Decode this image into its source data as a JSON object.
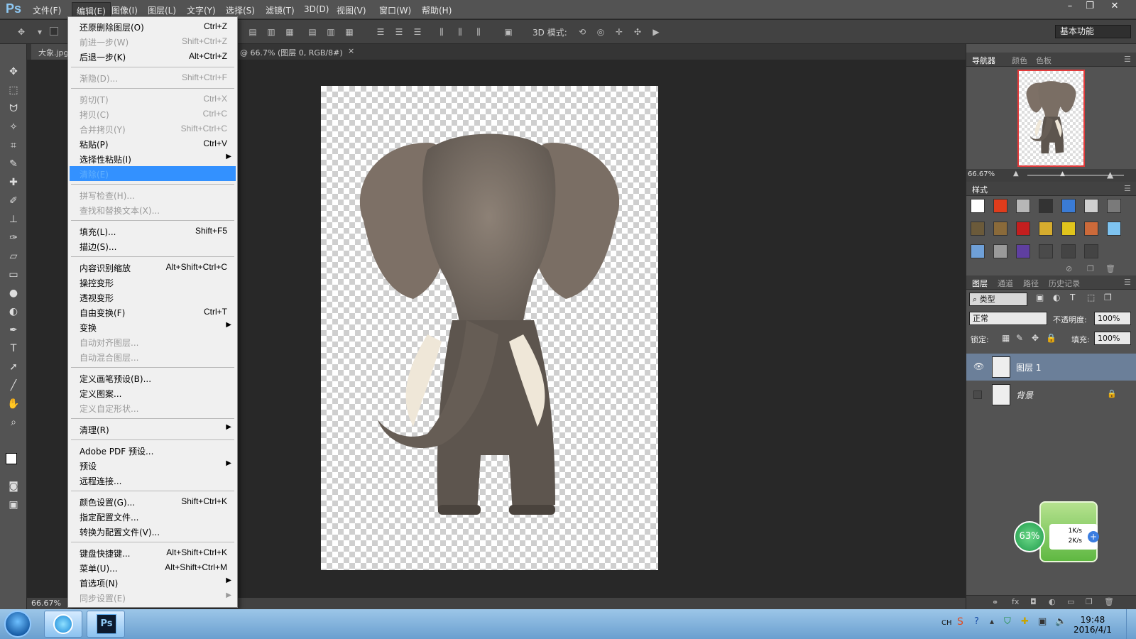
{
  "app": {
    "logo": "Ps"
  },
  "menubar": {
    "items": [
      "文件(F)",
      "编辑(E)",
      "图像(I)",
      "图层(L)",
      "文字(Y)",
      "选择(S)",
      "滤镜(T)",
      "3D(D)",
      "视图(V)",
      "窗口(W)",
      "帮助(H)"
    ],
    "active_index": 1
  },
  "window_controls": {
    "minimize": "–",
    "restore": "❐",
    "close": "✕"
  },
  "options_bar": {
    "mode_label": "3D 模式:",
    "workspace": "基本功能"
  },
  "tabs": {
    "doc_name": "大象.jpg",
    "doc_info": "@ 66.7% (图层 0, RGB/8#)",
    "close": "×"
  },
  "statusbar": {
    "zoom": "66.67%"
  },
  "edit_menu": {
    "groups": [
      [
        {
          "label": "还原删除图层(O)",
          "shortcut": "Ctrl+Z",
          "disabled": false
        },
        {
          "label": "前进一步(W)",
          "shortcut": "Shift+Ctrl+Z",
          "disabled": true
        },
        {
          "label": "后退一步(K)",
          "shortcut": "Alt+Ctrl+Z",
          "disabled": false
        }
      ],
      [
        {
          "label": "渐隐(D)...",
          "shortcut": "Shift+Ctrl+F",
          "disabled": true
        }
      ],
      [
        {
          "label": "剪切(T)",
          "shortcut": "Ctrl+X",
          "disabled": true
        },
        {
          "label": "拷贝(C)",
          "shortcut": "Ctrl+C",
          "disabled": true
        },
        {
          "label": "合并拷贝(Y)",
          "shortcut": "Shift+Ctrl+C",
          "disabled": true
        },
        {
          "label": "粘贴(P)",
          "shortcut": "Ctrl+V",
          "disabled": false
        },
        {
          "label": "选择性粘贴(I)",
          "shortcut": "",
          "disabled": false,
          "submenu": true
        },
        {
          "label": "清除(E)",
          "shortcut": "",
          "disabled": true,
          "highlight": true
        }
      ],
      [
        {
          "label": "拼写检查(H)...",
          "shortcut": "",
          "disabled": true
        },
        {
          "label": "查找和替换文本(X)...",
          "shortcut": "",
          "disabled": true
        }
      ],
      [
        {
          "label": "填充(L)...",
          "shortcut": "Shift+F5",
          "disabled": false
        },
        {
          "label": "描边(S)...",
          "shortcut": "",
          "disabled": false
        }
      ],
      [
        {
          "label": "内容识别缩放",
          "shortcut": "Alt+Shift+Ctrl+C",
          "disabled": false
        },
        {
          "label": "操控变形",
          "shortcut": "",
          "disabled": false
        },
        {
          "label": "透视变形",
          "shortcut": "",
          "disabled": false
        },
        {
          "label": "自由变换(F)",
          "shortcut": "Ctrl+T",
          "disabled": false
        },
        {
          "label": "变换",
          "shortcut": "",
          "disabled": false,
          "submenu": true
        },
        {
          "label": "自动对齐图层...",
          "shortcut": "",
          "disabled": true
        },
        {
          "label": "自动混合图层...",
          "shortcut": "",
          "disabled": true
        }
      ],
      [
        {
          "label": "定义画笔预设(B)...",
          "shortcut": "",
          "disabled": false
        },
        {
          "label": "定义图案...",
          "shortcut": "",
          "disabled": false
        },
        {
          "label": "定义自定形状...",
          "shortcut": "",
          "disabled": true
        }
      ],
      [
        {
          "label": "清理(R)",
          "shortcut": "",
          "disabled": false,
          "submenu": true
        }
      ],
      [
        {
          "label": "Adobe PDF 预设...",
          "shortcut": "",
          "disabled": false
        },
        {
          "label": "预设",
          "shortcut": "",
          "disabled": false,
          "submenu": true
        },
        {
          "label": "远程连接...",
          "shortcut": "",
          "disabled": false
        }
      ],
      [
        {
          "label": "颜色设置(G)...",
          "shortcut": "Shift+Ctrl+K",
          "disabled": false
        },
        {
          "label": "指定配置文件...",
          "shortcut": "",
          "disabled": false
        },
        {
          "label": "转换为配置文件(V)...",
          "shortcut": "",
          "disabled": false
        }
      ],
      [
        {
          "label": "键盘快捷键...",
          "shortcut": "Alt+Shift+Ctrl+K",
          "disabled": false
        },
        {
          "label": "菜单(U)...",
          "shortcut": "Alt+Shift+Ctrl+M",
          "disabled": false
        },
        {
          "label": "首选项(N)",
          "shortcut": "",
          "disabled": false,
          "submenu": true
        },
        {
          "label": "同步设置(E)",
          "shortcut": "",
          "disabled": true,
          "submenu": true
        }
      ]
    ]
  },
  "navigator": {
    "tabs": [
      "导航器",
      "颜色",
      "色板"
    ],
    "zoom": "66.67%"
  },
  "styles_panel": {
    "title": "样式"
  },
  "layers_panel": {
    "tabs": [
      "图层",
      "通道",
      "路径",
      "历史记录"
    ],
    "filter": "类型",
    "blend_mode": "正常",
    "opacity_label": "不透明度:",
    "opacity": "100%",
    "lock_label": "锁定:",
    "fill_label": "填充:",
    "fill": "100%",
    "layers": [
      {
        "name": "图层 1",
        "visible": true,
        "selected": true,
        "locked": false
      },
      {
        "name": "背景",
        "visible": false,
        "selected": false,
        "locked": true
      }
    ]
  },
  "net_widget": {
    "percent": "63%",
    "up": "1K/s",
    "down": "2K/s"
  },
  "taskbar": {
    "time": "19:48",
    "date": "2016/4/1",
    "lang": "CH"
  },
  "colors": {
    "accent": "#3391ff",
    "panel": "#535353",
    "dark": "#282828"
  }
}
